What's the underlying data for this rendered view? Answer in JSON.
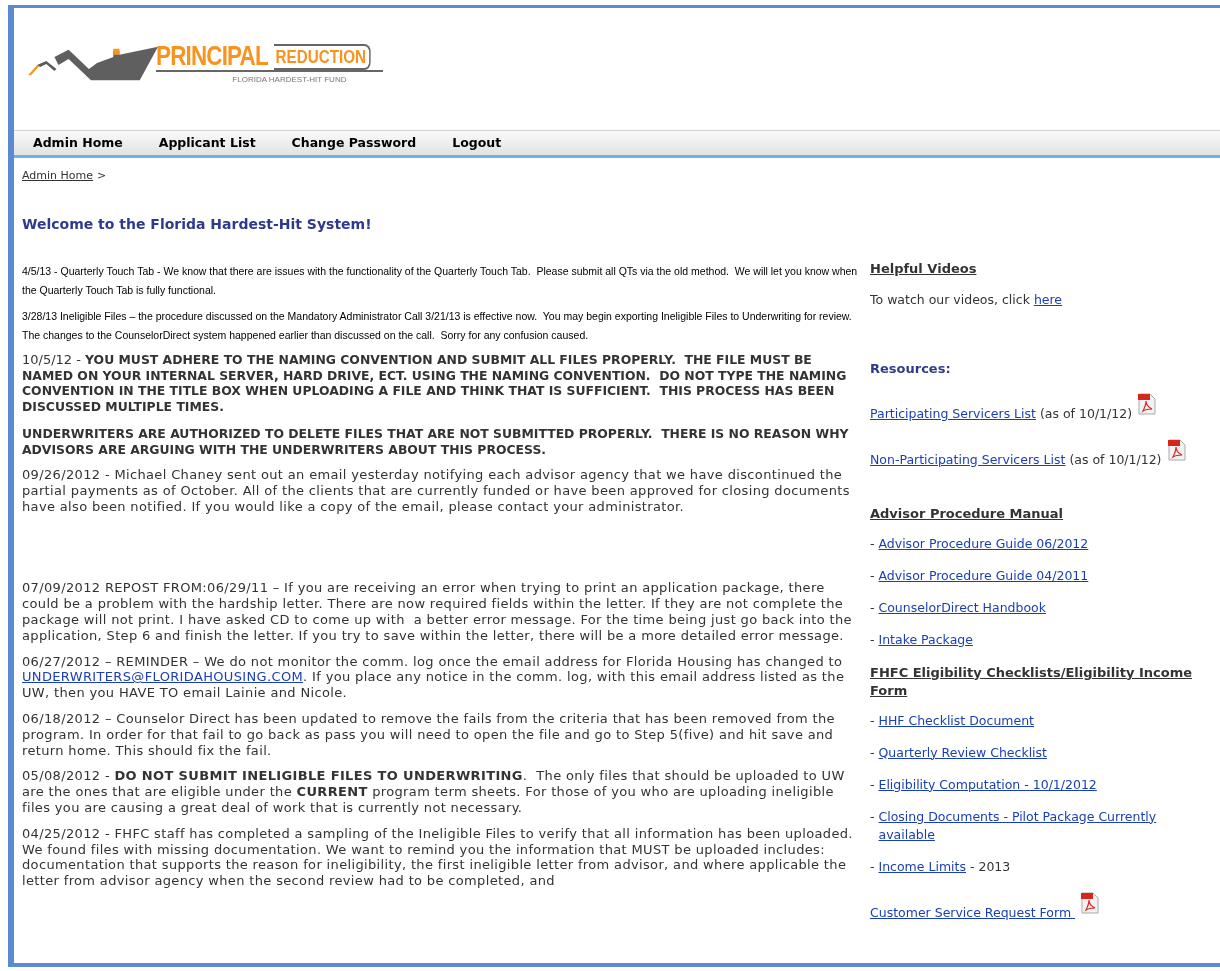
{
  "logo": {
    "word1": "PRINCIPAL",
    "word2": "REDUCTION",
    "subtitle": "FLORIDA HARDEST-HIT FUND"
  },
  "nav": [
    {
      "label": "Admin Home"
    },
    {
      "label": "Applicant List"
    },
    {
      "label": "Change Password"
    },
    {
      "label": "Logout"
    }
  ],
  "breadcrumb": {
    "link": "Admin Home",
    "separator": ">"
  },
  "welcome": "Welcome to the Florida Hardest-Hit System!",
  "notices": [
    {
      "kind": "small",
      "text": "4/5/13 - Quarterly Touch Tab - We know that there are issues with the functionality of the Quarterly Touch Tab.  Please submit all QTs via the old method.  We will let you know when the Quarterly Touch Tab is fully functional."
    },
    {
      "kind": "small",
      "text": "3/28/13 Ineligible Files – the procedure discussed on the Mandatory Administrator Call 3/21/13 is effective now.  You may begin exporting Ineligible Files to Underwriting for review.  The changes to the CounselorDirect system happened earlier than discussed on the call.  Sorry for any confusion caused."
    },
    {
      "kind": "loud",
      "text": "10/5/12 - **YOU MUST ADHERE TO THE NAMING CONVENTION AND SUBMIT ALL FILES PROPERLY.  THE FILE MUST BE NAMED ON YOUR INTERNAL SERVER, HARD DRIVE, ECT. USING THE NAMING CONVENTION.  DO NOT TYPE THE NAMING CONVENTION IN THE TITLE BOX WHEN UPLOADING A FILE AND THINK THAT IS SUFFICIENT.  THIS PROCESS HAS BEEN DISCUSSED MULTIPLE TIMES.**"
    },
    {
      "kind": "bold",
      "text": "UNDERWRITERS ARE AUTHORIZED TO DELETE FILES THAT ARE NOT SUBMITTED PROPERLY.  THERE IS NO REASON WHY ADVISORS ARE ARGUING WITH THE UNDERWRITERS ABOUT THIS PROCESS."
    },
    {
      "kind": "normal",
      "spaced": true,
      "text": "09/26/2012 - Michael Chaney sent out an email yesterday notifying each advisor agency that we have discontinued the partial payments as of October. All of the clients that are currently funded or have been approved for closing documents have also been notified. If you would like a copy of the email, please contact your administrator."
    },
    {
      "kind": "normal",
      "text": "07/09/2012 REPOST FROM:06/29/11 – If you are receiving an error when trying to print an application package, there could be a problem with the hardship letter. There are now required fields within the letter. If they are not complete the package will not print. I have asked CD to come up with  a better error message. For the time being just go back into the application, Step 6 and finish the letter. If you try to save within the letter, there will be a more detailed error message."
    },
    {
      "kind": "normal",
      "text": "06/27/2012 – REMINDER – We do not monitor the comm. log once the email address for Florida Housing has changed to ",
      "link": "UNDERWRITERS@FLORIDAHOUSING.COM",
      "after": ". If you place any notice in the comm. log, with this email address listed as the UW, then you HAVE TO email Lainie and Nicole."
    },
    {
      "kind": "normal",
      "text": "06/18/2012 – Counselor Direct has been updated to remove the fails from the criteria that has been removed from the program. In order for that fail to go back as pass you will need to open the file and go to Step 5(five) and hit save and return home. This should fix the fail."
    },
    {
      "kind": "normal",
      "text": "05/08/2012 - **DO NOT SUBMIT INELIGIBLE FILES TO UNDERWRITING**.  The only files that should be uploaded to UW are the ones that are eligible under the **CURRENT** program term sheets. For those of you who are uploading ineligible files you are causing a great deal of work that is currently not necessary."
    },
    {
      "kind": "normal",
      "text": "04/25/2012 - FHFC staff has completed a sampling of the Ineligible Files to verify that all information has been uploaded. We found files with missing documentation. We want to remind you the information that MUST be uploaded includes: documentation that supports the reason for ineligibility, the first ineligible letter from advisor, and where applicable the letter from advisor agency when the second review had to be completed, and"
    }
  ],
  "sidebar": [
    {
      "kind": "heading",
      "text": "Helpful Videos"
    },
    {
      "kind": "text_link",
      "text": "To watch our videos, click ",
      "link": "here"
    },
    {
      "kind": "section_title",
      "text": "Resources:"
    },
    {
      "kind": "pdf_link",
      "link": "Participating Servicers List",
      "note": " (as of 10/1/12)"
    },
    {
      "kind": "pdf_link",
      "link": "Non-Participating Servicers List",
      "note": " (as of 10/1/12)"
    },
    {
      "kind": "heading",
      "text": "Advisor Procedure Manual"
    },
    {
      "kind": "bullet_link",
      "bullet": "- ",
      "link": "Advisor Procedure Guide 06/2012"
    },
    {
      "kind": "bullet_link",
      "bullet": "- ",
      "link": "Advisor Procedure Guide 04/2011"
    },
    {
      "kind": "bullet_link",
      "bullet": "- ",
      "link": "CounselorDirect Handbook"
    },
    {
      "kind": "bullet_link",
      "bullet": "- ",
      "link": "Intake Package"
    },
    {
      "kind": "heading",
      "text": "FHFC Eligibility Checklists/Eligibility Income Form"
    },
    {
      "kind": "bullet_link",
      "bullet": "- ",
      "link": "HHF Checklist Document"
    },
    {
      "kind": "bullet_link",
      "bullet": "- ",
      "link": "Quarterly Review Checklist"
    },
    {
      "kind": "bullet_link",
      "bullet": "- ",
      "link": "Eligibility Computation - 10/1/2012"
    },
    {
      "kind": "bullet_link",
      "bullet": "- ",
      "link": "Closing Documents - Pilot Package Currently available"
    },
    {
      "kind": "bullet_link",
      "bullet": "- ",
      "link": "Income Limits",
      "note": " - 2013"
    },
    {
      "kind": "pdf_link",
      "link": "Customer Service Request Form "
    }
  ]
}
